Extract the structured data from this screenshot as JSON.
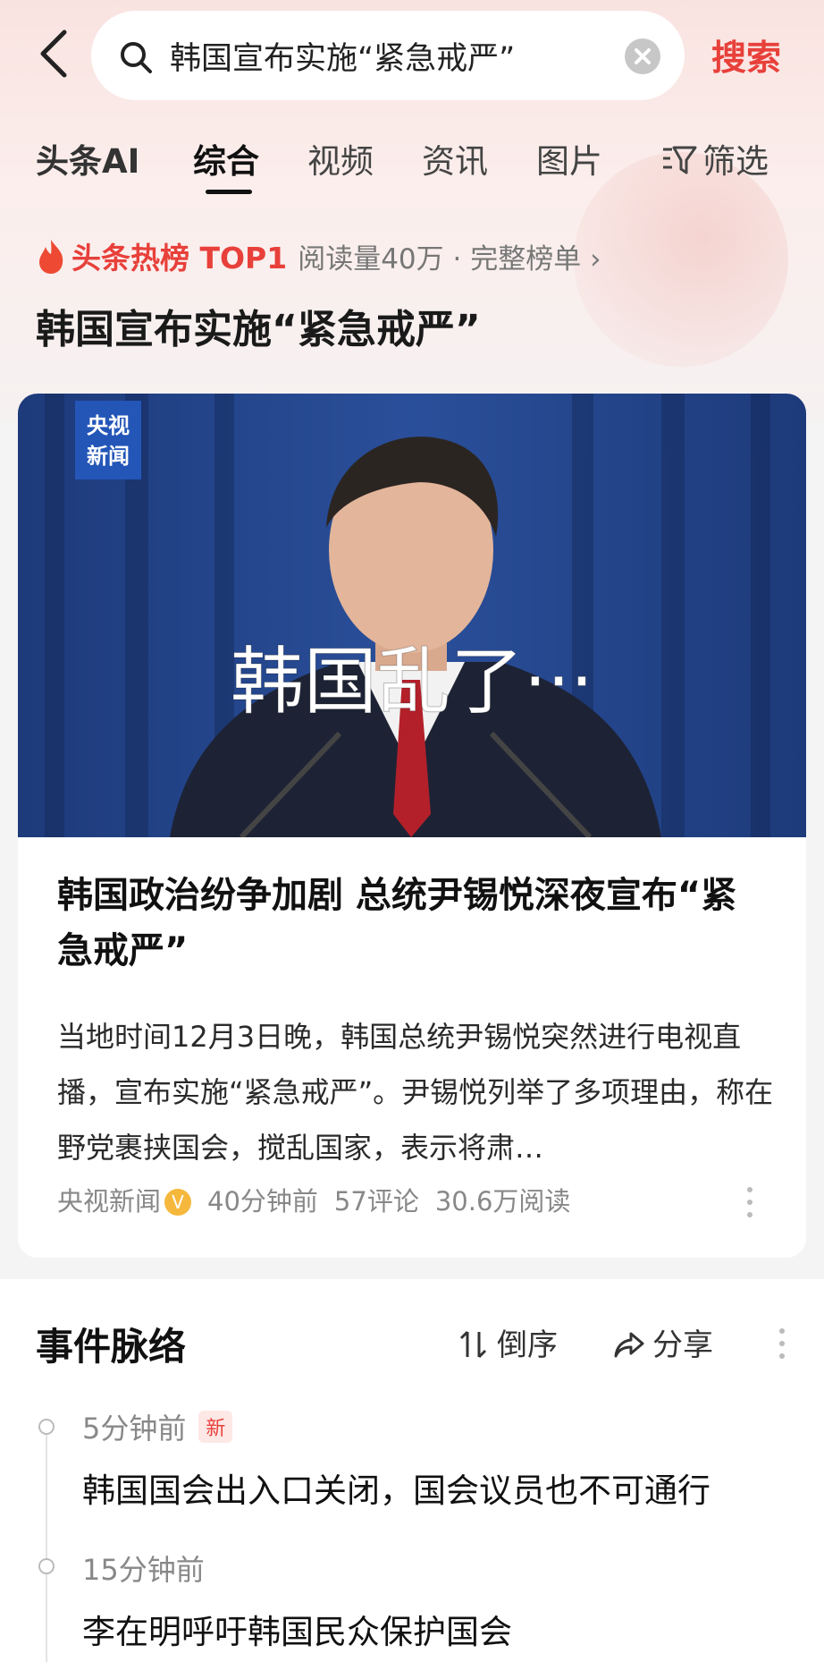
{
  "search": {
    "query": "韩国宣布实施“紧急戒严”",
    "button_label": "搜索"
  },
  "tabs": [
    {
      "label": "头条AI"
    },
    {
      "label": "综合"
    },
    {
      "label": "视频"
    },
    {
      "label": "资讯"
    },
    {
      "label": "图片"
    }
  ],
  "active_tab": "综合",
  "filter_label": "筛选",
  "hot": {
    "label": "头条热榜 TOP1",
    "meta": "阅读量40万 · 完整榜单 ›"
  },
  "headline": "韩国宣布实施“紧急戒严”",
  "card": {
    "image_logo": "央视\n新闻",
    "image_caption": "韩国乱了···",
    "title": "韩国政治纷争加剧 总统尹锡悦深夜宣布“紧急戒严”",
    "summary": "当地时间12月3日晚，韩国总统尹锡悦突然进行电视直播，宣布实施“紧急戒严”。尹锡悦列举了多项理由，称在野党裹挟国会，搅乱国家，表示将肃…",
    "source": "央视新闻",
    "time": "40分钟前",
    "comments": "57评论",
    "reads": "30.6万阅读"
  },
  "timeline": {
    "title": "事件脉络",
    "sort_label": "倒序",
    "share_label": "分享",
    "items": [
      {
        "time": "5分钟前",
        "badge": "新",
        "text": "韩国国会出入口关闭，国会议员也不可通行"
      },
      {
        "time": "15分钟前",
        "badge": "",
        "text": "李在明呼吁韩国民众保护国会"
      }
    ]
  },
  "colors": {
    "accent": "#e8403a",
    "verified": "#f5b83d"
  }
}
